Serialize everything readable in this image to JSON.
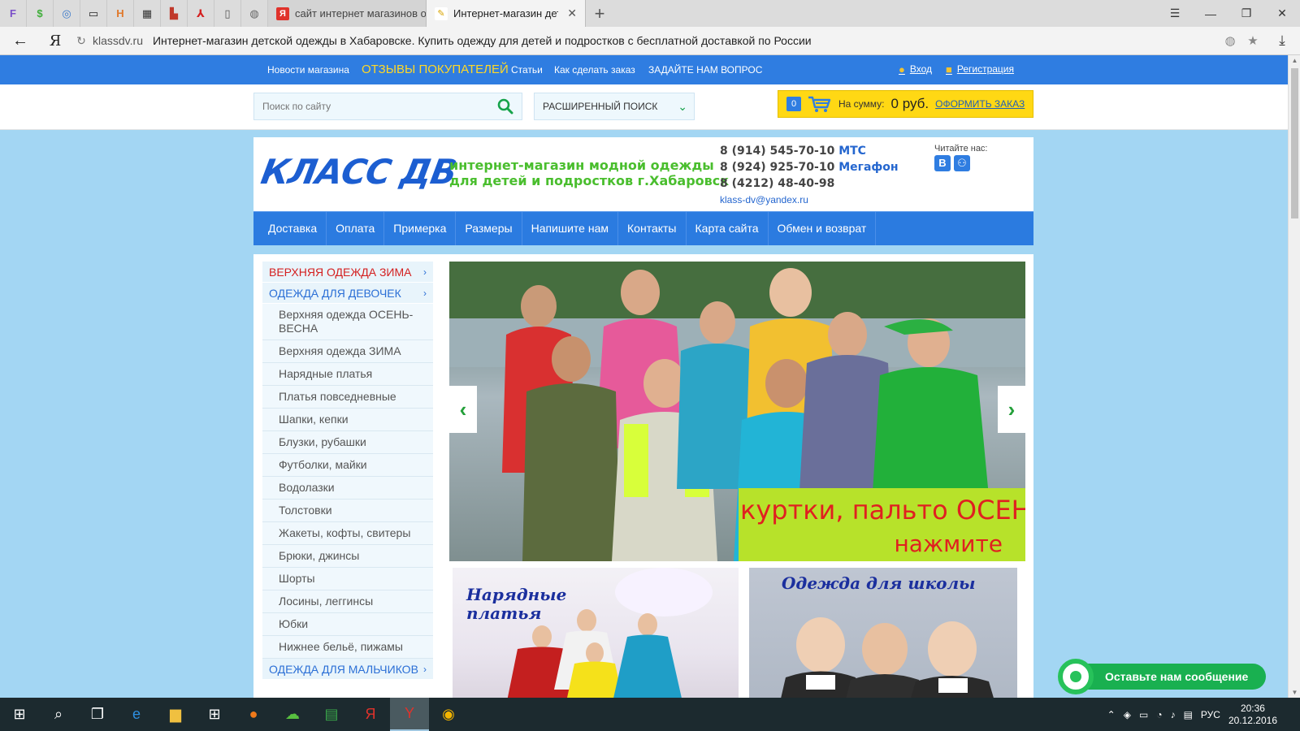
{
  "browser": {
    "pinned_tabs": [
      {
        "icon": "letter-f-icon",
        "glyph": "F",
        "color": "#7b4fc9"
      },
      {
        "icon": "dollar-icon",
        "glyph": "$",
        "color": "#3fae3a"
      },
      {
        "icon": "spiral-icon",
        "glyph": "◎",
        "color": "#3a79c9"
      },
      {
        "icon": "chat-bubble-icon",
        "glyph": "▭",
        "color": "#222222"
      },
      {
        "icon": "h-letter-icon",
        "glyph": "Н",
        "color": "#e0782a"
      },
      {
        "icon": "sth-icon",
        "glyph": "▦",
        "color": "#333333"
      },
      {
        "icon": "blocks-icon",
        "glyph": "▙",
        "color": "#c0392b"
      },
      {
        "icon": "flame-icon",
        "glyph": "⅄",
        "color": "#d42020"
      },
      {
        "icon": "document-icon",
        "glyph": "▯",
        "color": "#555555"
      },
      {
        "icon": "globe-icon",
        "glyph": "◍",
        "color": "#666666"
      }
    ],
    "tabs": [
      {
        "title": "сайт интернет магазинов о",
        "favicon": "Я",
        "favicon_color": "#e0322b",
        "active": false
      },
      {
        "title": "Интернет-магазин детск",
        "favicon": "✎",
        "favicon_color": "#d9a400",
        "active": true
      }
    ],
    "new_tab": "+",
    "window_controls": {
      "menu": "☰",
      "minimize": "—",
      "restore": "❐",
      "close": "✕"
    },
    "address": {
      "back": "←",
      "yandex": "Я",
      "reload": "↻",
      "url": "klassdv.ru",
      "page_title": "Интернет-магазин детской одежды в Хабаровске. Купить одежду для детей и подростков с бесплатной доставкой по России",
      "download": "⤓"
    }
  },
  "site": {
    "topnav": {
      "links": [
        "Новости магазина",
        "ОТЗЫВЫ ПОКУПАТЕЛЕЙ",
        "Статьи",
        "Как сделать заказ",
        "ЗАДАЙТЕ НАМ ВОПРОС"
      ],
      "login": "Вход",
      "register": "Регистрация"
    },
    "search": {
      "placeholder": "Поиск по сайту",
      "advanced": "РАСШИРЕННЫЙ ПОИСК"
    },
    "cart": {
      "count": "0",
      "sum_label": "На сумму:",
      "sum_value": "0 руб.",
      "checkout": "ОФОРМИТЬ ЗАКАЗ"
    },
    "header": {
      "logo": "КЛАСС ДВ",
      "slogan_line1": "интернет-магазин модной одежды",
      "slogan_line2": "для детей и подростков г.Хабаровск",
      "phones": [
        {
          "number": "8 (914) 545-70-10",
          "operator": "МТС"
        },
        {
          "number": "8 (924) 925-70-10",
          "operator": "Мегафон"
        },
        {
          "number": "8 (4212) 48-40-98",
          "operator": ""
        }
      ],
      "email": "klass-dv@yandex.ru",
      "social_label": "Читайте нас:",
      "social": [
        "В",
        "Ок"
      ]
    },
    "mainnav": [
      "Доставка",
      "Оплата",
      "Примерка",
      "Размеры",
      "Напишите нам",
      "Контакты",
      "Карта сайта",
      "Обмен и возврат"
    ],
    "sidebar": {
      "cat_winter": "ВЕРХНЯЯ ОДЕЖДА ЗИМА",
      "cat_girls": "ОДЕЖДА ДЛЯ ДЕВОЧЕК",
      "girls_items": [
        "Верхняя одежда ОСЕНЬ-ВЕСНА",
        "Верхняя одежда ЗИМА",
        "Нарядные платья",
        "Платья повседневные",
        "Шапки, кепки",
        "Блузки, рубашки",
        "Футболки, майки",
        "Водолазки",
        "Толстовки",
        "Жакеты, кофты, свитеры",
        "Брюки, джинсы",
        "Шорты",
        "Лосины, леггинсы",
        "Юбки",
        "Нижнее бельё, пижамы"
      ],
      "cat_boys": "ОДЕЖДА ДЛЯ МАЛЬЧИКОВ",
      "arrow": "›"
    },
    "slider": {
      "promo_line1": "куртки, пальто ОСЕНЬ",
      "promo_line2": "нажмите",
      "prev": "‹",
      "next": "›"
    },
    "cards": [
      {
        "title_line1": "Нарядные",
        "title_line2": "платья"
      },
      {
        "title_line1": "Одежда для школы",
        "title_line2": ""
      }
    ],
    "chat": "Оставьте нам сообщение"
  },
  "taskbar": {
    "language": "РУС",
    "time": "20:36",
    "date": "20.12.2016"
  }
}
